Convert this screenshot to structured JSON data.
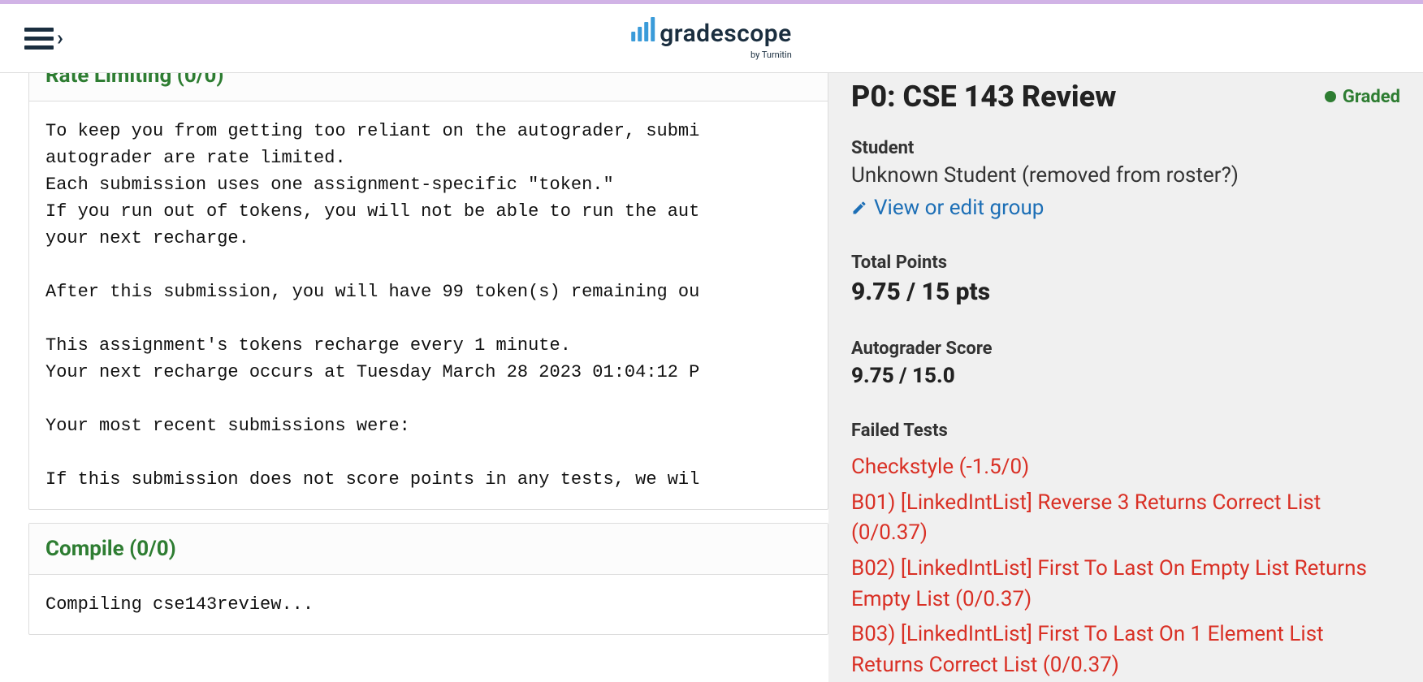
{
  "brand": {
    "name": "gradescope",
    "sub": "by Turnitin"
  },
  "sections": {
    "rate": {
      "title": "Rate Limiting (0/0)",
      "body": "To keep you from getting too reliant on the autograder, submi\nautograder are rate limited.\nEach submission uses one assignment-specific \"token.\"\nIf you run out of tokens, you will not be able to run the aut\nyour next recharge.\n\nAfter this submission, you will have 99 token(s) remaining ou\n\nThis assignment's tokens recharge every 1 minute.\nYour next recharge occurs at Tuesday March 28 2023 01:04:12 P\n\nYour most recent submissions were:\n\nIf this submission does not score points in any tests, we wil"
    },
    "compile": {
      "title": "Compile (0/0)",
      "body": "Compiling cse143review..."
    }
  },
  "sidebar": {
    "assignment_title": "P0: CSE 143 Review",
    "status": "Graded",
    "student_label": "Student",
    "student_name": "Unknown Student (removed from roster?)",
    "group_link": "View or edit group",
    "points_label": "Total Points",
    "points_value": "9.75 / 15 pts",
    "auto_label": "Autograder Score",
    "auto_value": "9.75 / 15.0",
    "failed_label": "Failed Tests",
    "failed": [
      "Checkstyle (-1.5/0)",
      "B01) [LinkedIntList] Reverse 3 Returns Correct List (0/0.37)",
      "B02) [LinkedIntList] First To Last On Empty List Returns Empty List (0/0.37)",
      "B03) [LinkedIntList] First To Last On 1 Element List Returns Correct List (0/0.37)"
    ]
  }
}
